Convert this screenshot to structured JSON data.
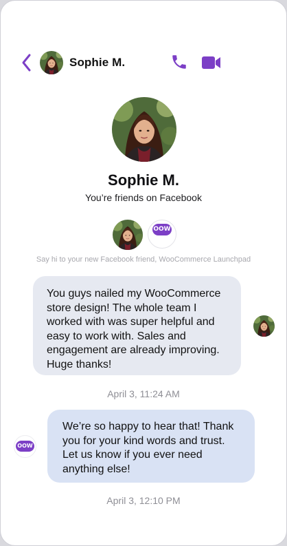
{
  "header": {
    "contact_name": "Sophie M."
  },
  "profile": {
    "name": "Sophie M.",
    "subtitle": "You’re friends on Facebook",
    "hint": "Say hi to your new Facebook friend, WooCommerce Launchpad"
  },
  "brand": {
    "logo_text": "OOW",
    "accent_color": "#7c3fc6"
  },
  "messages": [
    {
      "direction": "incoming",
      "text": "You guys nailed my WooCommerce store design! The whole team I worked with was super helpful and easy to work with. Sales and engagement are already improving. Huge thanks!",
      "time": "April 3, 11:24 AM"
    },
    {
      "direction": "outgoing",
      "text": "We’re so happy to hear that! Thank you for your kind words and trust. Let us know if you ever need anything else!",
      "time": "April 3, 12:10 PM"
    }
  ],
  "icons": [
    "back-icon",
    "phone-icon",
    "video-icon"
  ]
}
